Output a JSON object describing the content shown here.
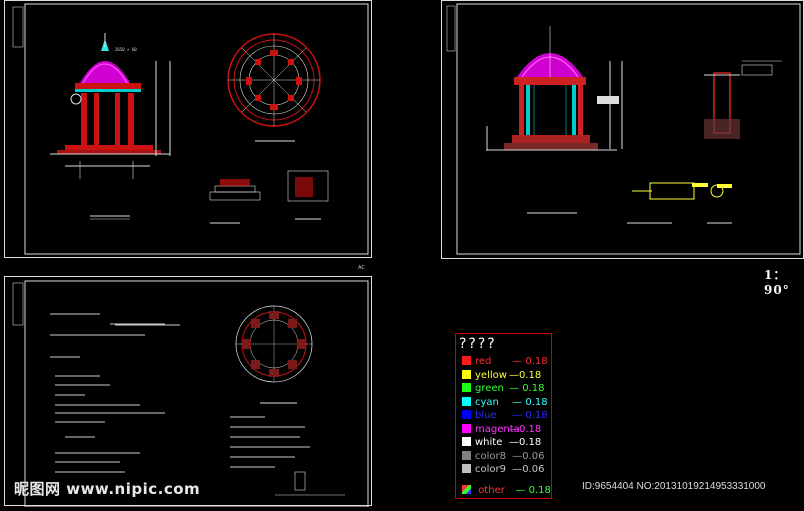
{
  "scale_label": "1：90°",
  "corner_mark": "AC",
  "legend": {
    "title": "????",
    "entries": [
      {
        "name": "red",
        "value": "0.18",
        "color": "#ff1a1a",
        "label_color": "#ff2a2a",
        "sep": " — "
      },
      {
        "name": "yellow",
        "value": "0.18",
        "color": "#ffff00",
        "label_color": "#ffff33",
        "sep": "—"
      },
      {
        "name": "green",
        "value": "0.18",
        "color": "#1aff1a",
        "label_color": "#33ff33",
        "sep": "— "
      },
      {
        "name": "cyan",
        "value": "0.18",
        "color": "#00ffff",
        "label_color": "#33ffff",
        "sep": " — "
      },
      {
        "name": "blue",
        "value": "0.18",
        "color": "#0000ff",
        "label_color": "#2a2aff",
        "sep": " — "
      },
      {
        "name": "magenta",
        "value": "0.18",
        "color": "#ff00ff",
        "label_color": "#ff33ff",
        "sep": "—"
      },
      {
        "name": "white",
        "value": "0.18",
        "color": "#ffffff",
        "label_color": "#ffffff",
        "sep": "—"
      },
      {
        "name": "color8",
        "value": "0.06",
        "color": "#808080",
        "label_color": "#9a9a9a",
        "sep": " —"
      },
      {
        "name": "color9",
        "value": "0.06",
        "color": "#c0c0c0",
        "label_color": "#c8c8c8",
        "sep": " —"
      }
    ],
    "other": {
      "name": "other",
      "value": "0.18",
      "label_color": "#ff3333",
      "sep": " — "
    }
  },
  "watermark": "昵图网 www.nipic.com",
  "image_stamp": "ID:9654404 NO:20131019214953331000"
}
